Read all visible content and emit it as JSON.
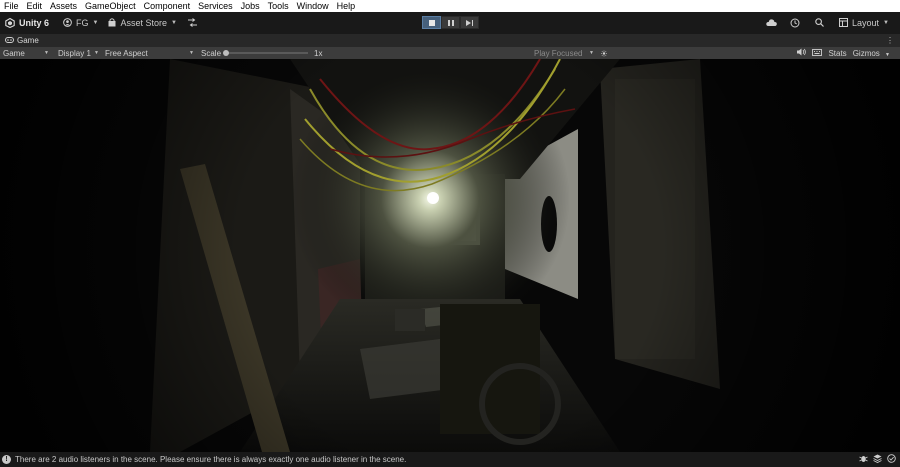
{
  "menu": [
    "File",
    "Edit",
    "Assets",
    "GameObject",
    "Component",
    "Services",
    "Jobs",
    "Tools",
    "Window",
    "Help"
  ],
  "toolbar": {
    "product": "Unity 6",
    "account": "FG",
    "asset_store": "Asset Store",
    "layout": "Layout"
  },
  "tab": {
    "label": "Game"
  },
  "game_toolbar": {
    "mode": "Game",
    "display": "Display 1",
    "aspect": "Free Aspect",
    "scale_label": "Scale",
    "scale_value": "1x",
    "play_mode": "Play Focused",
    "stats": "Stats",
    "gizmos": "Gizmos"
  },
  "status": {
    "message": "There are 2 audio listeners in the scene. Please ensure there is always exactly one audio listener in the scene."
  },
  "colors": {
    "accent": "#46607c",
    "menubar": "#ffffff",
    "background": "#191919"
  }
}
